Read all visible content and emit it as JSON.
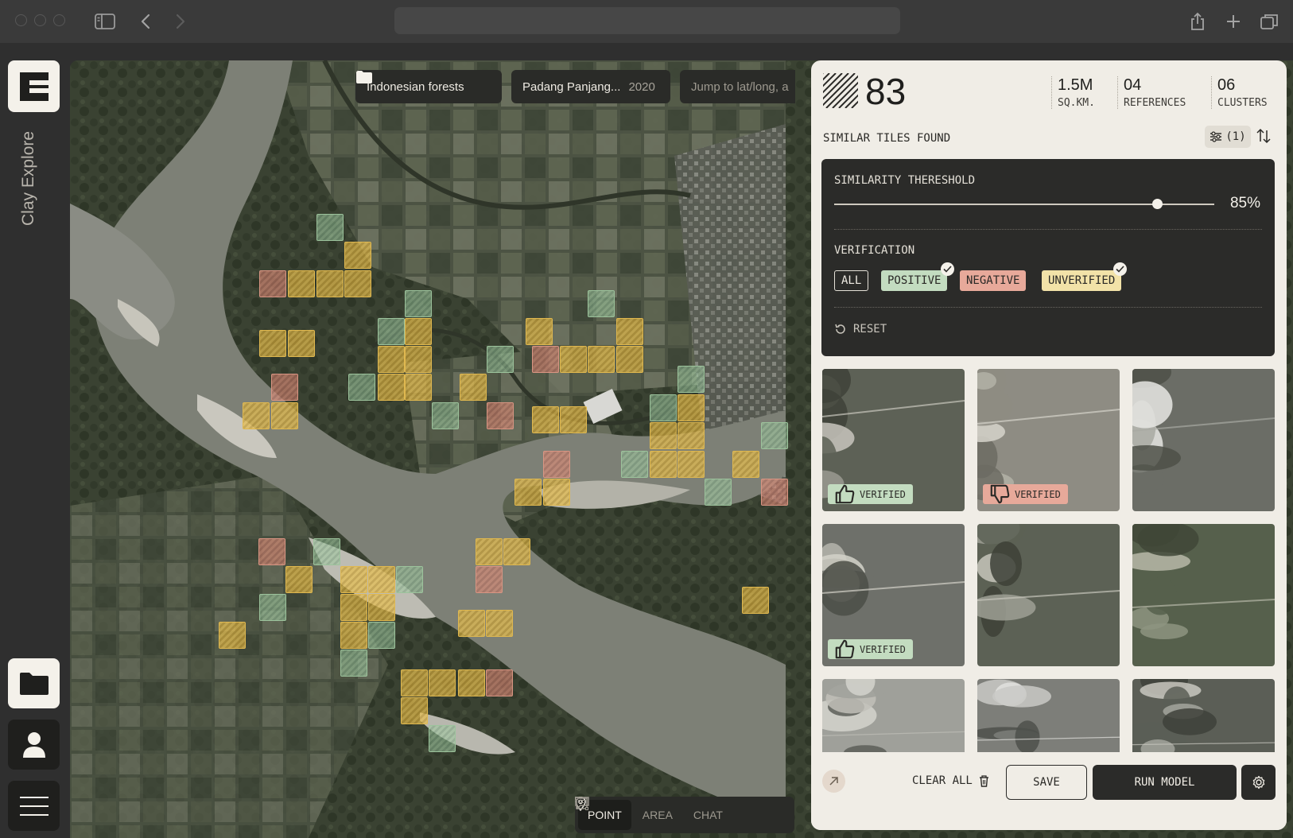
{
  "app": {
    "name": "Clay Explore"
  },
  "map": {
    "collection_label": "Indonesian forests",
    "location_label": "Padang Panjang...",
    "location_year": "2020",
    "jump_placeholder": "Jump to lat/long, a",
    "modes": [
      {
        "label": "POINT",
        "active": true,
        "icon": "pin-icon"
      },
      {
        "label": "AREA",
        "active": false,
        "icon": "area-icon"
      },
      {
        "label": "CHAT",
        "active": false,
        "icon": "chat-icon"
      }
    ]
  },
  "panel": {
    "tile_count": "83",
    "stats": [
      {
        "value": "1.5M",
        "label": "SQ.KM."
      },
      {
        "value": "04",
        "label": "REFERENCES"
      },
      {
        "value": "06",
        "label": "CLUSTERS"
      }
    ],
    "section_title": "SIMILAR TILES FOUND",
    "filter_count": "(1)",
    "filters": {
      "similarity_label": "SIMILARITY THERESHOLD",
      "similarity_value": "85%",
      "similarity_fraction": 0.85,
      "verification_label": "VERIFICATION",
      "chips": [
        {
          "label": "ALL",
          "checked": false
        },
        {
          "label": "POSITIVE",
          "checked": true
        },
        {
          "label": "NEGATIVE",
          "checked": false
        },
        {
          "label": "UNVERIFIED",
          "checked": true
        }
      ],
      "reset_label": "RESET"
    },
    "thumbnails": [
      {
        "badge": "VERIFIED",
        "badge_type": "positive"
      },
      {
        "badge": "VERIFIED",
        "badge_type": "negative"
      },
      {
        "badge": "",
        "badge_type": "none"
      },
      {
        "badge": "VERIFIED",
        "badge_type": "positive"
      },
      {
        "badge": "",
        "badge_type": "none"
      },
      {
        "badge": "",
        "badge_type": "none"
      },
      {
        "badge": "",
        "badge_type": "none"
      },
      {
        "badge": "",
        "badge_type": "none"
      },
      {
        "badge": "",
        "badge_type": "none"
      }
    ],
    "footer": {
      "clear_all_label": "CLEAR ALL",
      "save_label": "SAVE",
      "run_label": "RUN MODEL"
    }
  },
  "colors": {
    "positive": "#c3dcc0",
    "negative": "#e7a99a",
    "unverified": "#f2e2a8",
    "dark": "#2b2b29",
    "panel_bg": "#f0ede6"
  }
}
